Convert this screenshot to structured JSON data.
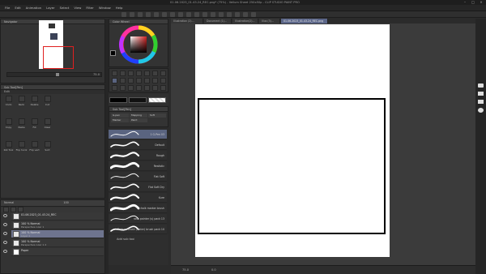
{
  "window": {
    "title": "01.06.2023_01.43.24_REC.png* (75%) - Vellum Sheet 250x50p - CLIP STUDIO PAINT PRO"
  },
  "menu": [
    "File",
    "Edit",
    "Animation",
    "Layer",
    "Select",
    "View",
    "Filter",
    "Window",
    "Help"
  ],
  "panels": {
    "navigator": "Navigator",
    "color_wheel": "Color Wheel",
    "sub_tool": "Sub Tool[Pen]",
    "edit": "Edit",
    "layer_header": "Normal",
    "layer_opacity": "100"
  },
  "edit_items": [
    {
      "label": "Undo",
      "icon": "undo-icon"
    },
    {
      "label": "Redo",
      "icon": "redo-icon"
    },
    {
      "label": "Delete",
      "icon": "delete-icon"
    },
    {
      "label": "Cut",
      "icon": "cut-icon"
    },
    {
      "label": "Copy",
      "icon": "copy-icon"
    },
    {
      "label": "Paste",
      "icon": "paste-icon"
    },
    {
      "label": "Fill",
      "icon": "fill-icon"
    },
    {
      "label": "Clear",
      "icon": "clear-icon"
    },
    {
      "label": "Rot Tool",
      "icon": "rotate-icon"
    },
    {
      "label": "Flip horiz",
      "icon": "flip-horizontal-icon"
    },
    {
      "label": "Flip vert",
      "icon": "flip-vertical-icon"
    },
    {
      "label": "Sort",
      "icon": "sort-icon"
    }
  ],
  "layers": [
    {
      "name": "01.06.2023_01.43.24_REC",
      "sub": "",
      "selected": false
    },
    {
      "name": "100 % Normal",
      "sub": "Perspective ruler 1",
      "selected": false
    },
    {
      "name": "100 % Normal",
      "sub": "Layer 1",
      "selected": true
    },
    {
      "name": "100 % Normal",
      "sub": "Perspective ruler 1 2",
      "selected": false
    },
    {
      "name": "Paper",
      "sub": "",
      "selected": false
    }
  ],
  "brush_tabs": [
    "G-pen",
    "Mapping",
    "Soft",
    "Marker",
    "Paint"
  ],
  "brushes": [
    {
      "name": "1 G-Pen 03",
      "selected": true
    },
    {
      "name": "Default",
      "selected": false
    },
    {
      "name": "Rough",
      "selected": false
    },
    {
      "name": "Realistic",
      "selected": false
    },
    {
      "name": "Flat Soft",
      "selected": false
    },
    {
      "name": "Flat Soft Dry",
      "selected": false
    },
    {
      "name": "Kure",
      "selected": false
    },
    {
      "name": "chalk marker brush",
      "selected": false
    },
    {
      "name": "rasa painter (s) pack 13",
      "selected": false
    },
    {
      "name": "Texture brush (water) brush pack 10",
      "selected": false
    }
  ],
  "add_sub_tool": "Add sub tool",
  "document_tabs": [
    {
      "label": "Illustration (2)...",
      "active": false
    },
    {
      "label": "Document (1)...",
      "active": false
    },
    {
      "label": "Illustration(2)...",
      "active": false
    },
    {
      "label": "Illus (3)...",
      "active": false
    },
    {
      "label": "01.06.2023_01.43.24_REC.png",
      "active": true
    }
  ],
  "status": {
    "zoom": "75.0",
    "coords": "0.0"
  },
  "colors": {
    "main": "#000000",
    "sub": "#ffffff"
  }
}
